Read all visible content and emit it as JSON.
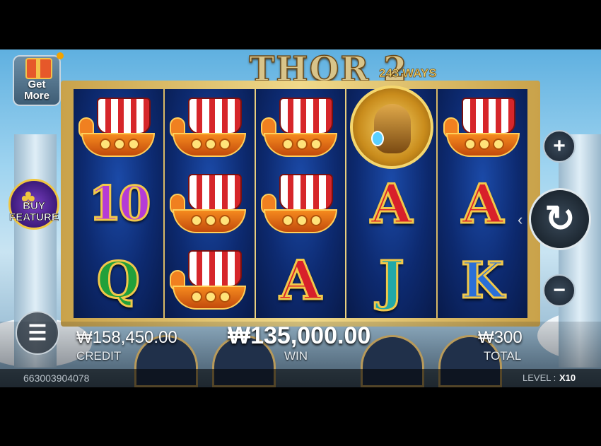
{
  "game": {
    "title": "THOR 2",
    "ways": "243 WAYS"
  },
  "side_left": {
    "get_more_label_1": "Get",
    "get_more_label_2": "More",
    "buy_feature_label_1": "BUY",
    "buy_feature_label_2": "FEATURE"
  },
  "controls": {
    "plus": "+",
    "minus": "−",
    "spin": "↻",
    "menu": "☰",
    "spin_arrow": "‹"
  },
  "reels": [
    [
      "ship",
      "10",
      "Q"
    ],
    [
      "ship",
      "ship",
      "ship"
    ],
    [
      "ship",
      "ship",
      "A"
    ],
    [
      "thor",
      "A",
      "J"
    ],
    [
      "ship",
      "A",
      "K"
    ]
  ],
  "symbol_icons": {
    "ship": "viking-ship-icon",
    "thor": "thor-portrait-icon"
  },
  "stats": {
    "credit_value": "₩158,450.00",
    "credit_label": "CREDIT",
    "win_value": "₩135,000.00",
    "win_label": "WIN",
    "total_value": "₩300",
    "total_label": "TOTAL"
  },
  "status": {
    "game_id": "663003904078",
    "level_label": "LEVEL :",
    "level_value": "X10"
  },
  "colors": {
    "reel_bg": "#0d2a70",
    "frame_gold": "#d8b45a",
    "letter_red": "#d8202a",
    "letter_blue": "#2a6fd8",
    "letter_green": "#22a03a"
  }
}
